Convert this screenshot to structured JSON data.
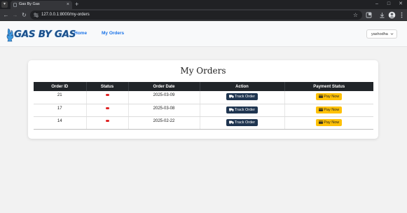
{
  "browser": {
    "tab_title": "Gas By Gas",
    "url": "127.0.0.1:8000/my-orders",
    "new_tab_symbol": "+",
    "tab_close_symbol": "×",
    "window_controls": {
      "minimize": "–",
      "maximize": "□",
      "close": "✕"
    }
  },
  "navbar": {
    "brand_text": "GAS BY GAS",
    "links": [
      {
        "label": "Home"
      },
      {
        "label": "My Orders"
      }
    ],
    "user": {
      "name": "yashodha"
    }
  },
  "page": {
    "title": "My Orders",
    "table": {
      "headers": [
        "Order ID",
        "Status",
        "Order Date",
        "Action",
        "Payment Status"
      ],
      "rows": [
        {
          "order_id": "21",
          "order_date": "2025-03-09",
          "action_label": "Track Order",
          "payment_label": "Pay Now"
        },
        {
          "order_id": "17",
          "order_date": "2025-03-08",
          "action_label": "Track Order",
          "payment_label": "Pay Now"
        },
        {
          "order_id": "14",
          "order_date": "2025-02-22",
          "action_label": "Track Order",
          "payment_label": "Pay Now"
        }
      ]
    }
  },
  "colors": {
    "table_header_bg": "#212529",
    "track_button_bg": "#1f3550",
    "pay_button_bg": "#ffc107",
    "status_indicator": "#e02424",
    "nav_link": "#1a73e8",
    "brand": "#1b4f8a"
  },
  "icons": {
    "browser": [
      "tab-list-icon",
      "back-icon",
      "forward-icon",
      "reload-icon",
      "site-info-icon",
      "bookmark-star-icon",
      "extensions-icon",
      "download-icon",
      "profile-icon",
      "menu-kebab-icon"
    ],
    "page": [
      "gas-cylinder-logo-icon",
      "chevron-down-icon",
      "truck-icon",
      "card-icon"
    ]
  }
}
